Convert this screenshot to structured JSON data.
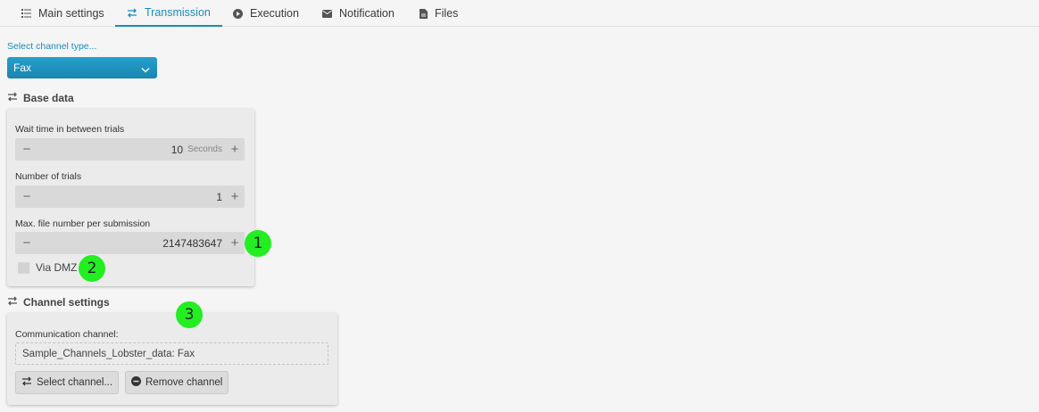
{
  "tabs": [
    {
      "label": "Main settings",
      "icon": "list-icon",
      "active": false
    },
    {
      "label": "Transmission",
      "icon": "transfer-icon",
      "active": true
    },
    {
      "label": "Execution",
      "icon": "play-icon",
      "active": false
    },
    {
      "label": "Notification",
      "icon": "mail-icon",
      "active": false
    },
    {
      "label": "Files",
      "icon": "file-icon",
      "active": false
    }
  ],
  "channel_type": {
    "label": "Select channel type...",
    "selected": "Fax"
  },
  "base_data": {
    "title": "Base data",
    "wait_time": {
      "label": "Wait time in between trials",
      "value": "10",
      "unit": "Seconds"
    },
    "trials": {
      "label": "Number of trials",
      "value": "1"
    },
    "max_files": {
      "label": "Max. file number per submission",
      "value": "2147483647"
    },
    "via_dmz": {
      "label": "Via DMZ",
      "checked": false
    }
  },
  "channel_settings": {
    "title": "Channel settings",
    "comm_label": "Communication channel:",
    "comm_value": "Sample_Channels_Lobster_data: Fax",
    "select_button": "Select channel...",
    "remove_button": "Remove channel"
  },
  "badges": [
    "1",
    "2",
    "3"
  ],
  "colors": {
    "accent": "#1a8cb8",
    "badge": "#22ee22"
  }
}
